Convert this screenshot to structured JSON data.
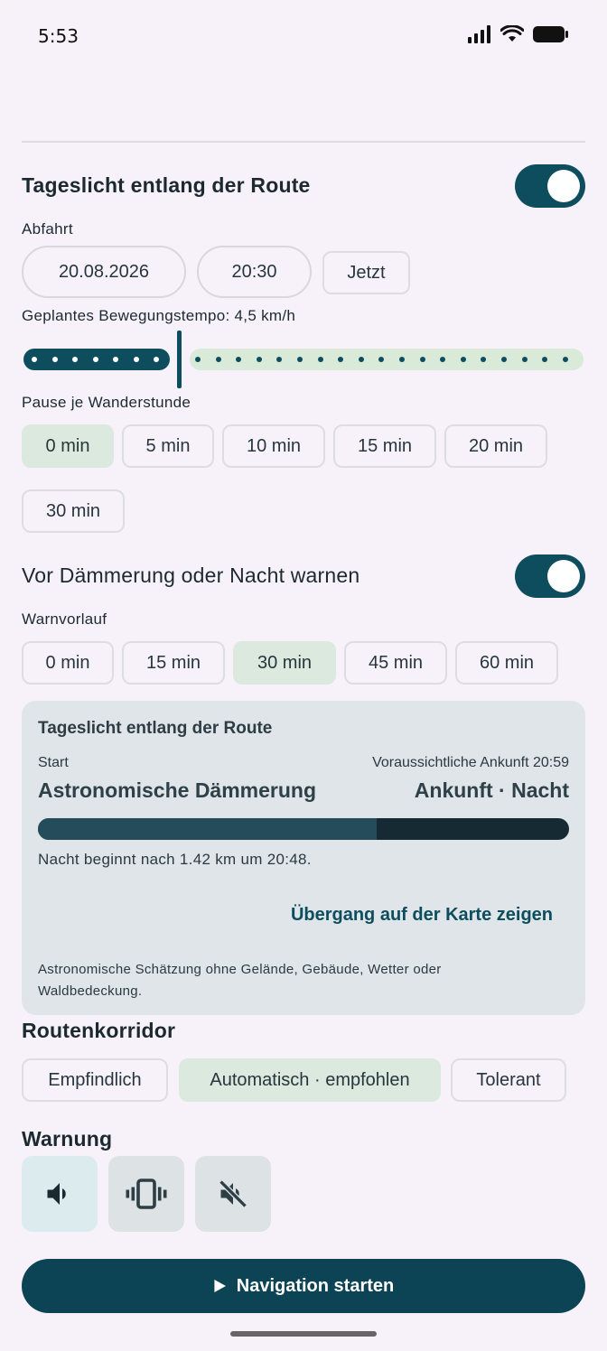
{
  "status": {
    "time": "5:53"
  },
  "daylight": {
    "title": "Tageslicht entlang der Route",
    "toggle_on": true,
    "departure_label": "Abfahrt",
    "date": "20.08.2026",
    "time": "20:30",
    "now_label": "Jetzt",
    "pace_label": "Geplantes Bewegungstempo: 4,5 km/h",
    "pace_kmh": 4.5,
    "pause_label": "Pause je Wanderstunde",
    "pause_options": [
      "0 min",
      "5 min",
      "10 min",
      "15 min",
      "20 min",
      "30 min"
    ],
    "pause_selected": "0 min"
  },
  "warn": {
    "title": "Vor Dämmerung oder Nacht warnen",
    "toggle_on": true,
    "lead_label": "Warnvorlauf",
    "lead_options": [
      "0 min",
      "15 min",
      "30 min",
      "45 min",
      "60 min"
    ],
    "lead_selected": "30 min"
  },
  "card": {
    "title": "Tageslicht entlang der Route",
    "start_label": "Start",
    "eta": "Voraussichtliche Ankunft 20:59",
    "start_phase": "Astronomische Dämmerung",
    "end_phase": "Ankunft · Nacht",
    "progress_fraction": 0.637,
    "note": "Nacht beginnt nach 1.42 km um 20:48.",
    "link": "Übergang auf der Karte zeigen",
    "disclaimer": "Astronomische Schätzung ohne Gelände, Gebäude, Wetter oder Waldbedeckung."
  },
  "corridor": {
    "title": "Routenkorridor",
    "options": [
      "Empfindlich",
      "Automatisch · empfohlen",
      "Tolerant"
    ],
    "selected": "Automatisch · empfohlen"
  },
  "alert": {
    "title": "Warnung",
    "modes": [
      "sound-icon",
      "vibrate-icon",
      "mute-icon"
    ],
    "selected": "sound-icon"
  },
  "start_button": {
    "label": "Navigation starten",
    "icon": "play-icon"
  },
  "colors": {
    "primary": "#0d4d5e",
    "selected_chip": "#dbe9de",
    "background": "#f7f2f9"
  }
}
